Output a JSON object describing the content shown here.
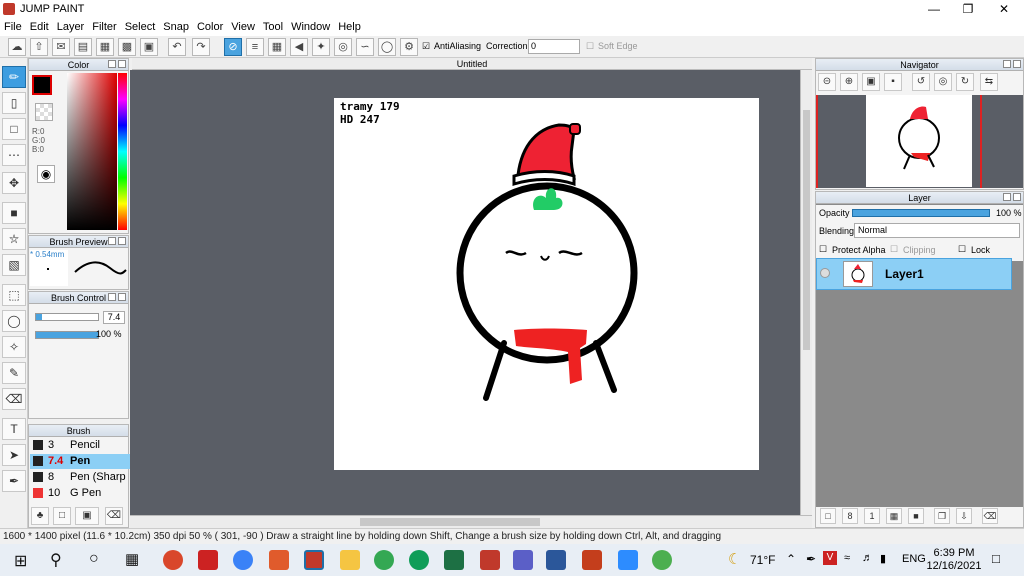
{
  "app": {
    "title": "JUMP PAINT"
  },
  "menu": [
    "File",
    "Edit",
    "Layer",
    "Filter",
    "Select",
    "Snap",
    "Color",
    "View",
    "Tool",
    "Window",
    "Help"
  ],
  "toolbar": {
    "antialiasing_label": "AntiAliasing",
    "correction_label": "Correction",
    "correction_value": "0",
    "soft_edge_label": "Soft Edge"
  },
  "document": {
    "tab_title": "Untitled"
  },
  "panels": {
    "color": {
      "title": "Color",
      "r": "R:0",
      "g": "G:0",
      "b": "B:0"
    },
    "brush_preview": {
      "title": "Brush Preview",
      "size": "* 0.54mm"
    },
    "brush_control": {
      "title": "Brush Control",
      "size_value": "7.4",
      "opacity_value": "100 %"
    },
    "brush": {
      "title": "Brush",
      "items": [
        {
          "size": "3",
          "name": "Pencil"
        },
        {
          "size": "7.4",
          "name": "Pen"
        },
        {
          "size": "8",
          "name": "Pen (Sharp"
        },
        {
          "size": "10",
          "name": "G Pen"
        }
      ]
    },
    "navigator": {
      "title": "Navigator"
    },
    "layer": {
      "title": "Layer",
      "opacity_label": "Opacity",
      "opacity_value": "100 %",
      "blending_label": "Blending",
      "blending_value": "Normal",
      "protect_alpha": "Protect Alpha",
      "clipping": "Clipping",
      "lock": "Lock",
      "layer_name": "Layer1"
    }
  },
  "canvas": {
    "signature": [
      "tramy 179",
      "HD 247"
    ]
  },
  "status": {
    "text": "1600 * 1400 pixel   (11.6 * 10.2cm)   350 dpi   50 %   ( 301, -90 )   Draw a straight line by holding down Shift, Change a brush size by holding down Ctrl, Alt, and dragging"
  },
  "taskbar": {
    "weather": "71°F",
    "lang": "ENG",
    "time": "6:39 PM",
    "date": "12/16/2021"
  }
}
